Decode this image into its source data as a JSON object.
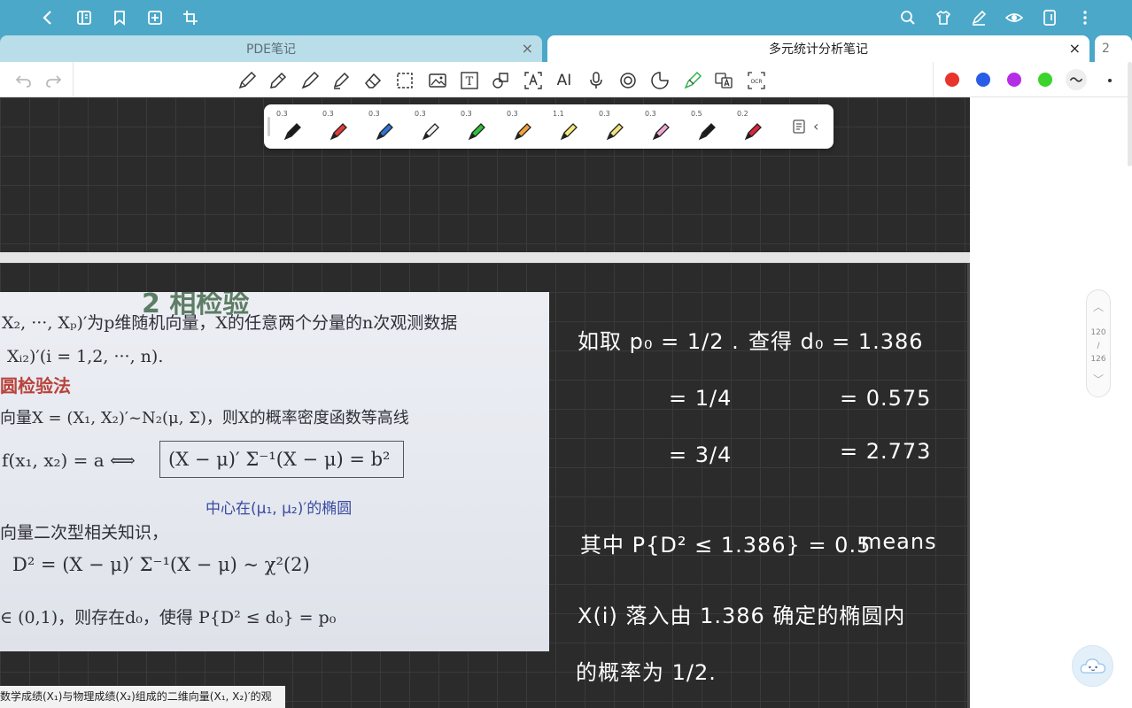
{
  "tabs": [
    {
      "label": "PDE笔记",
      "close": "×"
    },
    {
      "label": "多元统计分析笔记",
      "close": "×"
    }
  ],
  "tab_overflow_count": "2",
  "toolbar": {
    "text_tool_label": "T",
    "ai_label": "AI",
    "ocr_label": "OCR",
    "colors": [
      "#e8342b",
      "#2a5de6",
      "#b42ee6",
      "#3ad42c"
    ]
  },
  "pen_sizes": [
    "0.3",
    "0.3",
    "0.3",
    "0.3",
    "0.3",
    "0.3",
    "1.1",
    "0.3",
    "0.3",
    "0.5",
    "0.2"
  ],
  "pen_colors": [
    "#1a1a1a",
    "#e23b3b",
    "#2e74d6",
    "#f2f2f2",
    "#2fc23a",
    "#f2a23a",
    "#f3ea7a",
    "#f2e27a",
    "#f0a8d2",
    "#1a1a1a",
    "#e0243a"
  ],
  "pager": {
    "current": "120",
    "separator": "/",
    "total": "126"
  },
  "screenshot": {
    "heading": "2 相检验",
    "line1": "X₂, ···, Xₚ)′为p维随机向量，X的任意两个分量的n次观测数据",
    "line2": "Xᵢ₂)′(i = 1,2, ···, n).",
    "section": "圆检验法",
    "line3": "向量X = (X₁, X₂)′~N₂(μ, Σ)，则X的概率密度函数等高线",
    "line4a": "f(x₁, x₂) = a ⟺",
    "line4b": "(X − μ)′ Σ⁻¹(X − μ) = b²",
    "center": "中心在(μ₁, μ₂)′的椭圆",
    "line5": "向量二次型相关知识，",
    "line6": "D² = (X − μ)′ Σ⁻¹(X − μ) ~ χ²(2)",
    "line7": "∈ (0,1)，则存在d₀，使得 P{D² ≤ d₀} = p₀",
    "bottom": "数学成绩(X₁)与物理成绩(X₂)组成的二维向量(X₁, X₂)′的观"
  },
  "notes": {
    "row1_left": "如取 p₀ = 1/2 .",
    "row1_right": "查得 d₀ = 1.386",
    "row2_left": "= 1/4",
    "row2_right": "= 0.575",
    "row3_left": "= 3/4",
    "row3_right": "= 2.773",
    "row4": "其中 P{D² ≤ 1.386} = 0.5",
    "row4_right": "means",
    "row5": "X(i) 落入由 1.386 确定的椭圆内",
    "row6": "的概率为 1/2."
  }
}
